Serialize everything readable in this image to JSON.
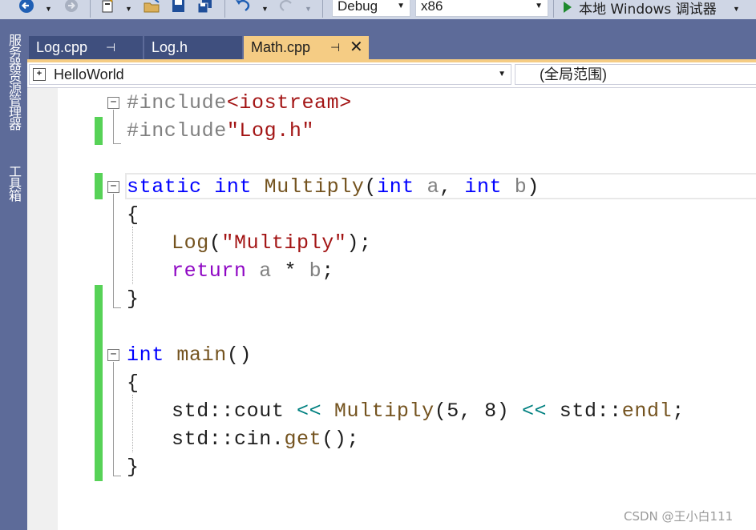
{
  "toolbar": {
    "back_icon": "navigate-back-icon",
    "forward_icon": "navigate-forward-icon",
    "new_project_icon": "new-project-icon",
    "open_icon": "open-folder-icon",
    "save_icon": "save-icon",
    "save_all_icon": "save-all-icon",
    "undo_icon": "undo-icon",
    "redo_icon": "redo-icon",
    "configuration": "Debug",
    "platform": "x86",
    "run_icon": "play-icon",
    "run_label": "本地 Windows 调试器"
  },
  "side_panels": [
    "服务器资源管理器",
    "工具箱"
  ],
  "tabs": [
    {
      "label": "Log.cpp",
      "pin": "⊣",
      "active": false
    },
    {
      "label": "Log.h",
      "active": false
    },
    {
      "label": "Math.cpp",
      "pin": "⊣",
      "active": true
    }
  ],
  "navbar": {
    "project": "HelloWorld",
    "scope": "(全局范围)"
  },
  "code": {
    "line1": {
      "pp": "#include",
      "inc": "<iostream>"
    },
    "line2": {
      "pp": "#include",
      "inc": "\"Log.h\""
    },
    "line4": {
      "kw1": "static",
      "kw2": "int",
      "fn": "Multiply",
      "p1": "(",
      "kw3": "int",
      "a": "a",
      "comma": ", ",
      "kw4": "int",
      "b": "b",
      "p2": ")"
    },
    "line5": "{",
    "line6": {
      "fn": "Log",
      "open": "(",
      "str": "\"Multiply\"",
      "close": ");"
    },
    "line7": {
      "kw": "return",
      "a": "a",
      "op": " * ",
      "b": "b",
      "semi": ";"
    },
    "line8": "}",
    "line10": {
      "kw": "int",
      "fn": "main",
      "rest": "()"
    },
    "line11": "{",
    "line12": {
      "ns1": "std::",
      "cout": "cout",
      "op1": " << ",
      "fn": "Multiply",
      "open": "(",
      "n1": "5",
      "comma": ", ",
      "n2": "8",
      "close": ")",
      "op2": " << ",
      "ns2": "std::",
      "endl": "endl",
      "semi": ";"
    },
    "line13": {
      "ns": "std::",
      "obj": "cin",
      "dot": ".",
      "fn": "get",
      "rest": "();"
    },
    "line14": "}"
  },
  "watermark": "CSDN @王小白111",
  "colors": {
    "keyword": "#0000ff",
    "include_path": "#a31515",
    "function": "#74531f",
    "control": "#8f08c4",
    "number": "#098658",
    "operator": "#008080",
    "change_bar": "#57d257",
    "active_tab": "#f5cc84",
    "chrome": "#5d6b99"
  }
}
